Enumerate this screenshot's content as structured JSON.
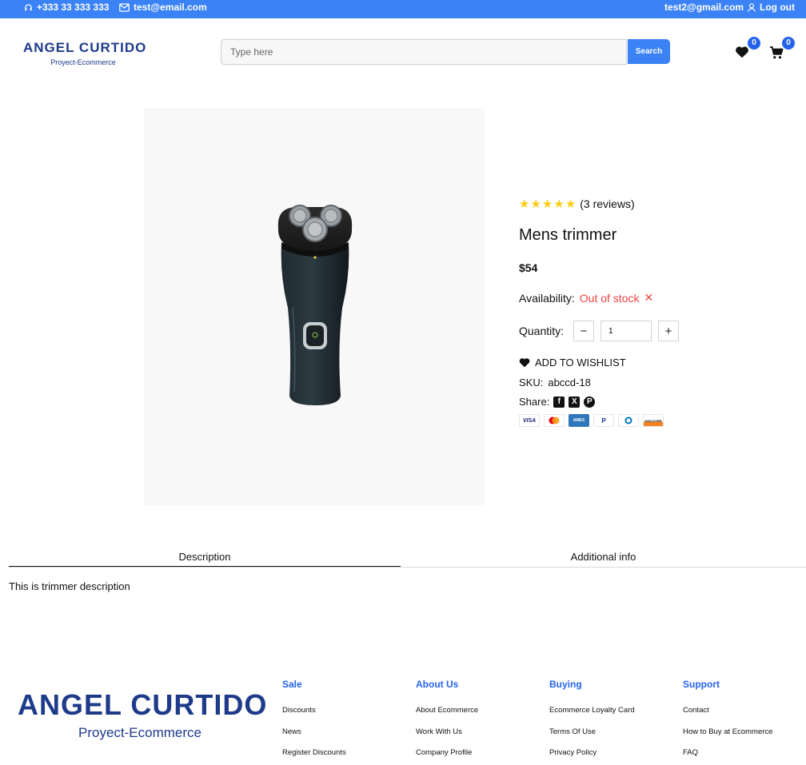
{
  "topbar": {
    "phone": "+333 33 333 333",
    "email": "test@email.com",
    "user_email": "test2@gmail.com",
    "logout": "Log out"
  },
  "header": {
    "brand_name": "ANGEL CURTIDO",
    "brand_sub": "Proyect-Ecommerce",
    "search_placeholder": "Type here",
    "search_button": "Search",
    "wishlist_count": "0",
    "cart_count": "0"
  },
  "product": {
    "rating_stars": 5,
    "reviews": "(3 reviews)",
    "title": "Mens trimmer",
    "price": "$54",
    "availability_label": "Availability:",
    "availability_value": "Out of stock",
    "quantity_label": "Quantity:",
    "quantity_value": "1",
    "wishlist_label": "ADD TO WISHLIST",
    "sku_label": "SKU:",
    "sku_value": "abccd-18",
    "share_label": "Share:",
    "payment_methods": [
      "VISA",
      "mastercard",
      "AMEX",
      "PayPal",
      "Diners",
      "DISCOVER"
    ]
  },
  "tabs": [
    {
      "label": "Description",
      "active": true
    },
    {
      "label": "Additional info",
      "active": false
    }
  ],
  "description_text": "This is trimmer description",
  "footer": {
    "brand_name": "ANGEL CURTIDO",
    "brand_sub": "Proyect-Ecommerce",
    "columns": [
      {
        "heading": "Sale",
        "links": [
          "Discounts",
          "News",
          "Register Discounts"
        ]
      },
      {
        "heading": "About Us",
        "links": [
          "About Ecommerce",
          "Work With Us",
          "Company Profile"
        ]
      },
      {
        "heading": "Buying",
        "links": [
          "Ecommerce Loyalty Card",
          "Terms Of Use",
          "Privacy Policy"
        ]
      },
      {
        "heading": "Support",
        "links": [
          "Contact",
          "How to Buy at Ecommerce",
          "FAQ"
        ]
      }
    ]
  },
  "colors": {
    "accent": "#3b82f6",
    "brand": "#1e3a8a",
    "out_of_stock": "#ef4444",
    "star": "#facc15"
  }
}
